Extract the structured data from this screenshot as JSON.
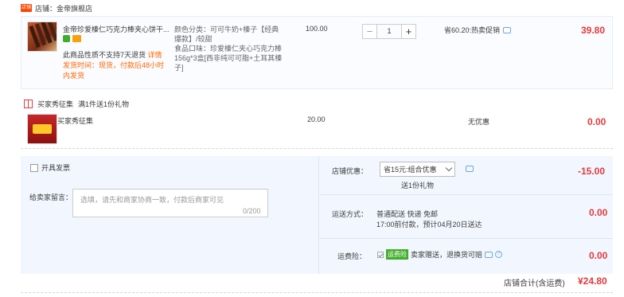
{
  "shop": {
    "badge": "店铺",
    "label": "店铺：金帝旗舰店"
  },
  "item": {
    "title": "金帝珍爱榛仁巧克力棒夹心饼干...",
    "notice_prefix": "此商品性质不支持7天退货",
    "notice_link": "详情",
    "notice_ship": "发货时间：现货，付款后48小时内发货",
    "attrs": "颜色分类：可可牛奶+榛子【经典爆款】/较甜",
    "flavor": "食品口味：珍爱榛仁夹心巧克力棒156g*3盒[西非纯可可脂+土耳其榛子]",
    "unit_price": "100.00",
    "quantity": "1",
    "minus": "−",
    "plus": "+",
    "promo": "省60.20:热卖促销",
    "subtotal": "39.80"
  },
  "gift": {
    "label": "买家秀征集",
    "desc": "满1件送1份礼物",
    "name": "买家秀征集",
    "unit_price": "20.00",
    "discount": "无优惠",
    "subtotal": "0.00"
  },
  "invoice": {
    "label": "开具发票"
  },
  "message": {
    "label": "给卖家留言：",
    "placeholder": "选填，请先和商家协商一致，付款后商家可见",
    "count": "0/200"
  },
  "shop_discount": {
    "label": "店铺优惠：",
    "selected": "省15元:组合优惠",
    "note": "送1份礼物",
    "amount": "-15.00"
  },
  "shipping": {
    "label": "运送方式：",
    "method": "普通配送 快递 免邮",
    "eta": "17:00前付款，预计04月20日送达",
    "amount": "0.00"
  },
  "insurance": {
    "label": "运费险：",
    "badge": "运费险",
    "text": "卖家赠送，退换货可赔",
    "help": "?",
    "amount": "0.00"
  },
  "total": {
    "label": "店铺合计(含运费)",
    "amount": "¥24.80"
  },
  "colors": {
    "accent": "#e4393c",
    "panel": "#f2f7ff",
    "green": "#3fae29"
  }
}
